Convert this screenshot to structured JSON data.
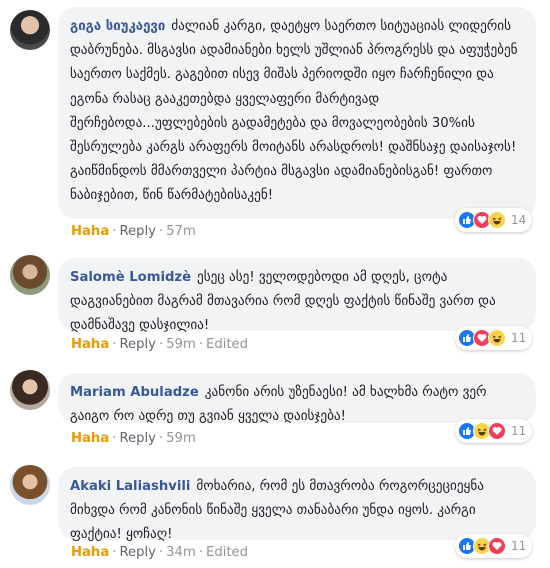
{
  "comments": [
    {
      "author": "გიგა სიუკაევი",
      "text": "ძალიან კარგი, დაეტყო საერთო სიტუაციას ლიდერის დაბრუნება. მსგავსი ადამიანები ხელს უშლიან პროგრესს და აფუჭებენ საერთო საქმეს. გაგებით ისევ მიშას პერიოდში იყო ჩარჩენილი და ეგონა რასაც გააკეთებდა ყველაფერი მარტივად შერჩებოდა...უფლებების გადამეტება და მოვალეობების 30%ის შესრულება კარგს არაფერს მოიტანს არასდროს! დაშნსაჯე დაისაჯოს! გაიწმინდოს მმართველი პარტია მსგავსი ადამიანებისგან! ფართო ნაბიჯებით, წინ წარმატებისაკენ!",
      "reaction_label": "Haha",
      "reply_label": "Reply",
      "time": "57m",
      "edited": "",
      "reaction_count": "14",
      "reactions": [
        "like-icon",
        "love-icon",
        "haha-icon"
      ]
    },
    {
      "author": "Salomè Lomidzè",
      "text": "ესეც ასე! ველოდებოდი ამ დღეს, ცოტა დაგვიანებით მაგრამ მთავარია რომ დღეს ფაქტის წინაშე ვართ და დამნაშავე დასჯილია!",
      "reaction_label": "Haha",
      "reply_label": "Reply",
      "time": "59m",
      "edited": "Edited",
      "reaction_count": "11",
      "reactions": [
        "like-icon",
        "love-icon",
        "haha-icon"
      ]
    },
    {
      "author": "Mariam Abuladze",
      "text": "კანონი არის უზენაესი! ამ ხალხმა რატო ვერ გაიგო რო ადრე თუ გვიან ყველა დაისჯება!",
      "reaction_label": "Haha",
      "reply_label": "Reply",
      "time": "59m",
      "edited": "",
      "reaction_count": "11",
      "reactions": [
        "like-icon",
        "haha-icon",
        "love-icon"
      ]
    },
    {
      "author": "Akaki Laliashvili",
      "text": "მოხარია, რომ ეს მთავრობა როგორცეციეყნა მიხვდა რომ კანონის წინაშე ყველა თანაბარი უნდა იყოს. კარგი ფაქტია! ყოჩაღ!",
      "reaction_label": "Haha",
      "reply_label": "Reply",
      "time": "34m",
      "edited": "Edited",
      "reaction_count": "11",
      "reactions": [
        "like-icon",
        "haha-icon",
        "love-icon"
      ]
    }
  ],
  "colors": {
    "author": "#385898",
    "haha": "#ec9b00",
    "bubble": "#f2f3f5",
    "like": "#1877f2",
    "love": "#f33e58"
  }
}
